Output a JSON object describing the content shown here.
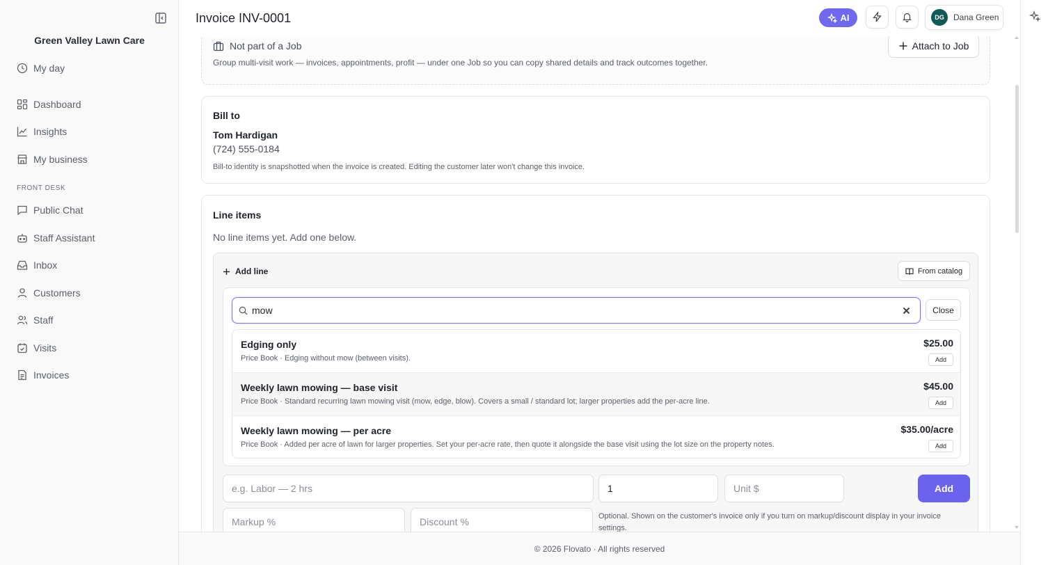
{
  "sidebar": {
    "org_name": "Green Valley Lawn Care",
    "my_day": "My day",
    "items": [
      {
        "label": "Dashboard",
        "icon": "dashboard-icon"
      },
      {
        "label": "Insights",
        "icon": "chart-line-icon"
      },
      {
        "label": "My business",
        "icon": "store-icon"
      }
    ],
    "section_label": "FRONT DESK",
    "front_desk_items": [
      {
        "label": "Public Chat",
        "icon": "message-icon"
      },
      {
        "label": "Staff Assistant",
        "icon": "bot-icon"
      },
      {
        "label": "Inbox",
        "icon": "inbox-icon"
      },
      {
        "label": "Customers",
        "icon": "user-icon"
      },
      {
        "label": "Staff",
        "icon": "users-icon"
      },
      {
        "label": "Visits",
        "icon": "calendar-check-icon"
      },
      {
        "label": "Invoices",
        "icon": "file-text-icon"
      }
    ]
  },
  "header": {
    "title": "Invoice INV-0001",
    "ai_label": "AI",
    "user": {
      "initials": "DG",
      "name": "Dana Green"
    }
  },
  "job": {
    "title": "Not part of a Job",
    "description": "Group multi-visit work — invoices, appointments, profit — under one Job so you can copy shared details and track outcomes together.",
    "attach_label": "Attach to Job"
  },
  "bill_to": {
    "heading": "Bill to",
    "name": "Tom Hardigan",
    "phone": "(724) 555-0184",
    "note": "Bill-to identity is snapshotted when the invoice is created. Editing the customer later won't change this invoice."
  },
  "line_items": {
    "heading": "Line items",
    "empty_text": "No line items yet. Add one below.",
    "add_line_label": "Add line",
    "from_catalog_label": "From catalog",
    "search_value": "mow",
    "close_label": "Close",
    "results": [
      {
        "name": "Edging only",
        "description": "Price Book · Edging without mow (between visits).",
        "price": "$25.00",
        "add_label": "Add"
      },
      {
        "name": "Weekly lawn mowing — base visit",
        "description": "Price Book · Standard recurring lawn mowing visit (mow, edge, blow). Covers a small / standard lot; larger properties add the per-acre line.",
        "price": "$45.00",
        "add_label": "Add"
      },
      {
        "name": "Weekly lawn mowing — per acre",
        "description": "Price Book · Added per acre of lawn for larger properties. Set your per-acre rate, then quote it alongside the base visit using the lot size on the property notes.",
        "price": "$35.00/acre",
        "add_label": "Add"
      }
    ],
    "form": {
      "description_placeholder": "e.g. Labor — 2 hrs",
      "quantity_value": "1",
      "unit_price_placeholder": "Unit $",
      "add_label": "Add",
      "markup_placeholder": "Markup %",
      "discount_placeholder": "Discount %",
      "note": "Optional. Shown on the customer's invoice only if you turn on markup/discount display in your invoice settings."
    }
  },
  "footer": {
    "text": "© 2026 Flovato · All rights reserved"
  },
  "colors": {
    "accent": "#6b63ee",
    "avatar": "#0f5b58",
    "sidebar_bg": "#f9f9fa"
  }
}
